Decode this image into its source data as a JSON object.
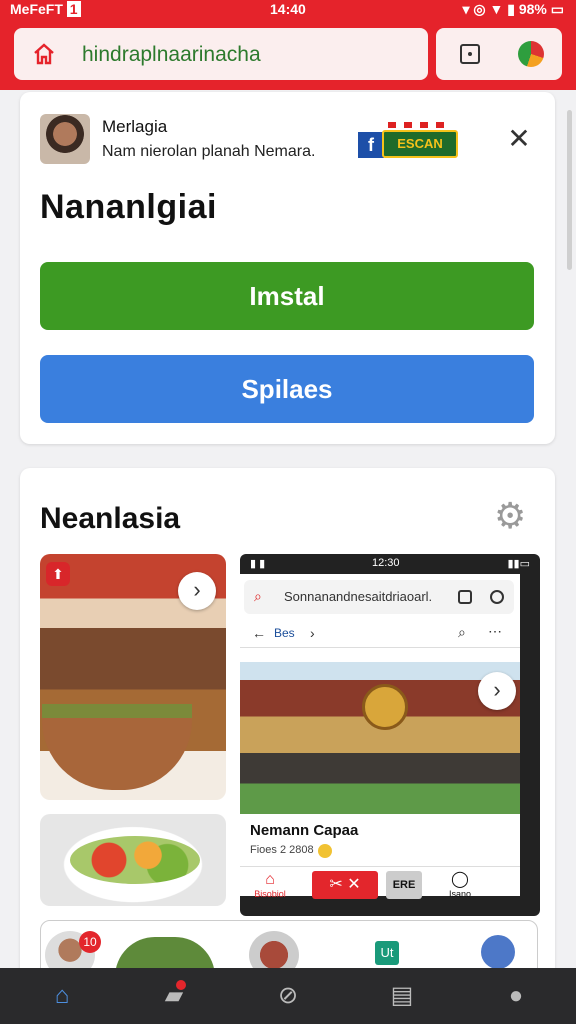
{
  "status": {
    "carrier": "MeFeFT",
    "sim": "1",
    "time": "14:40",
    "battery": "98%"
  },
  "browser": {
    "url": "hindraplnaarinacha"
  },
  "app": {
    "name": "Merlagia",
    "description": "Nam nierolan planah Nemara.",
    "badge_text": "ESCAN",
    "title": "Nananlgiai",
    "install_label": "Imstal",
    "secondary_label": "Spilaes"
  },
  "section": {
    "title": "Neanlasia"
  },
  "preview": {
    "status_time": "12:30",
    "url": "Sonnanandnesaitdriaoarl.",
    "nav_label": "Bes",
    "caption_title": "Nemann Capaa",
    "caption_sub": "Fioes 2 2808",
    "tabs": [
      {
        "label": "Bisobiol"
      },
      {
        "label": "Isano"
      }
    ],
    "gray_tab": "ERE"
  },
  "strip": {
    "badge": "10",
    "icon_text": "Ut"
  },
  "colors": {
    "brand": "#e5232b",
    "install": "#3d9a23",
    "secondary": "#3a7fde"
  }
}
